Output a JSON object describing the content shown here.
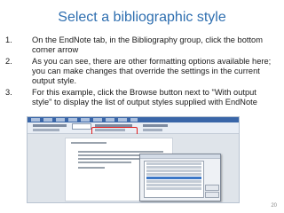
{
  "slide": {
    "title": "Select a bibliographic style",
    "page_number": "20",
    "accent_color": "#2f6fb0"
  },
  "steps": [
    {
      "number": "1.",
      "text": "On the EndNote tab, in the Bibliography group, click the bottom corner arrow"
    },
    {
      "number": "2.",
      "text": "As you can see, there are other formatting options available here; you can make changes that override the settings in the current output style."
    },
    {
      "number": "3.",
      "text": "For this example, click the Browse button next to \"With output style\" to display the list of output styles supplied with EndNote"
    }
  ],
  "screenshot": {
    "highlight_color": "#e21b1b"
  }
}
